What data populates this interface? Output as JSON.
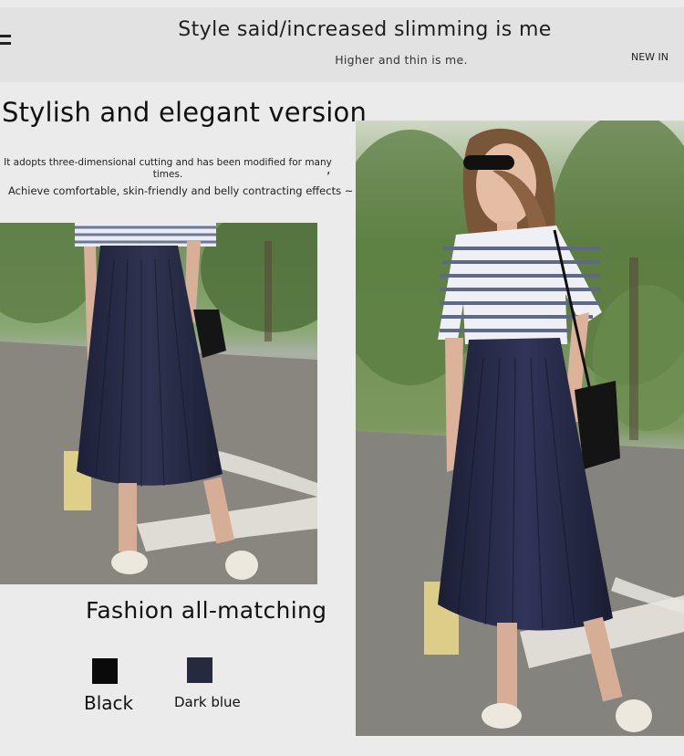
{
  "header": {
    "menu_icon": "hamburger-menu-icon",
    "title": "Style said/increased slimming is me",
    "subtitle": "Higher and thin is me.",
    "new_in": "NEW IN"
  },
  "intro": {
    "title": "Stylish and elegant version",
    "description_line1": "It adopts three-dimensional cutting and has been modified for many times.",
    "description_comma": ",",
    "description_line2": "Achieve comfortable, skin-friendly and belly contracting effects ~"
  },
  "photos": {
    "small": "model-skirt-closeup-photo",
    "large": "model-full-body-photo"
  },
  "colors_section": {
    "title": "Fashion all-matching",
    "options": [
      {
        "label": "Black",
        "color": "#0a0a0a"
      },
      {
        "label": "Dark blue",
        "color": "#262a3f"
      }
    ]
  }
}
